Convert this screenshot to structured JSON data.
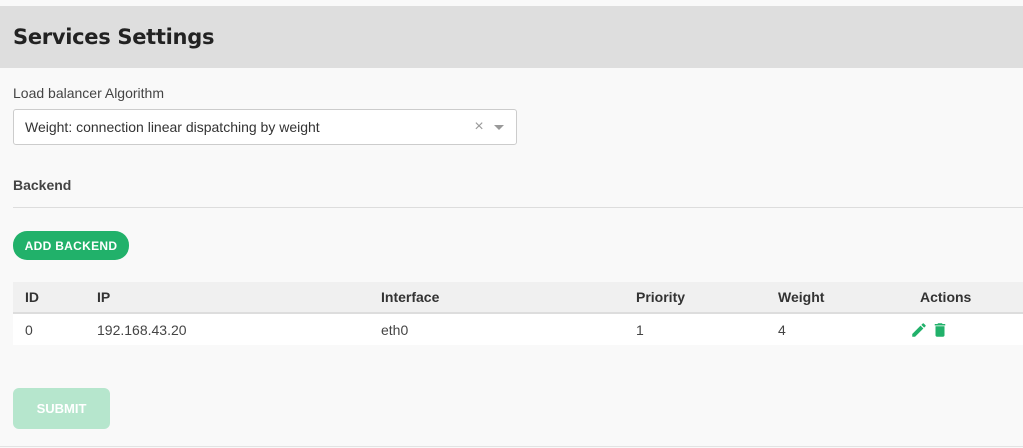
{
  "header": {
    "title": "Services Settings"
  },
  "algorithm": {
    "label": "Load balancer Algorithm",
    "selected": "Weight: connection linear dispatching by weight",
    "clear_glyph": "×"
  },
  "backend": {
    "section_title": "Backend",
    "add_label": "ADD BACKEND",
    "table": {
      "columns": [
        "ID",
        "IP",
        "Interface",
        "Priority",
        "Weight",
        "Actions"
      ],
      "rows": [
        {
          "id": "0",
          "ip": "192.168.43.20",
          "interface": "eth0",
          "priority": "1",
          "weight": "4"
        }
      ]
    }
  },
  "submit_label": "SUBMIT",
  "icons": {
    "edit": "pencil-icon",
    "delete": "trash-icon"
  },
  "colors": {
    "accent": "#21b16a",
    "submit_disabled": "#b6e6cd",
    "header_bg": "#dedede"
  }
}
